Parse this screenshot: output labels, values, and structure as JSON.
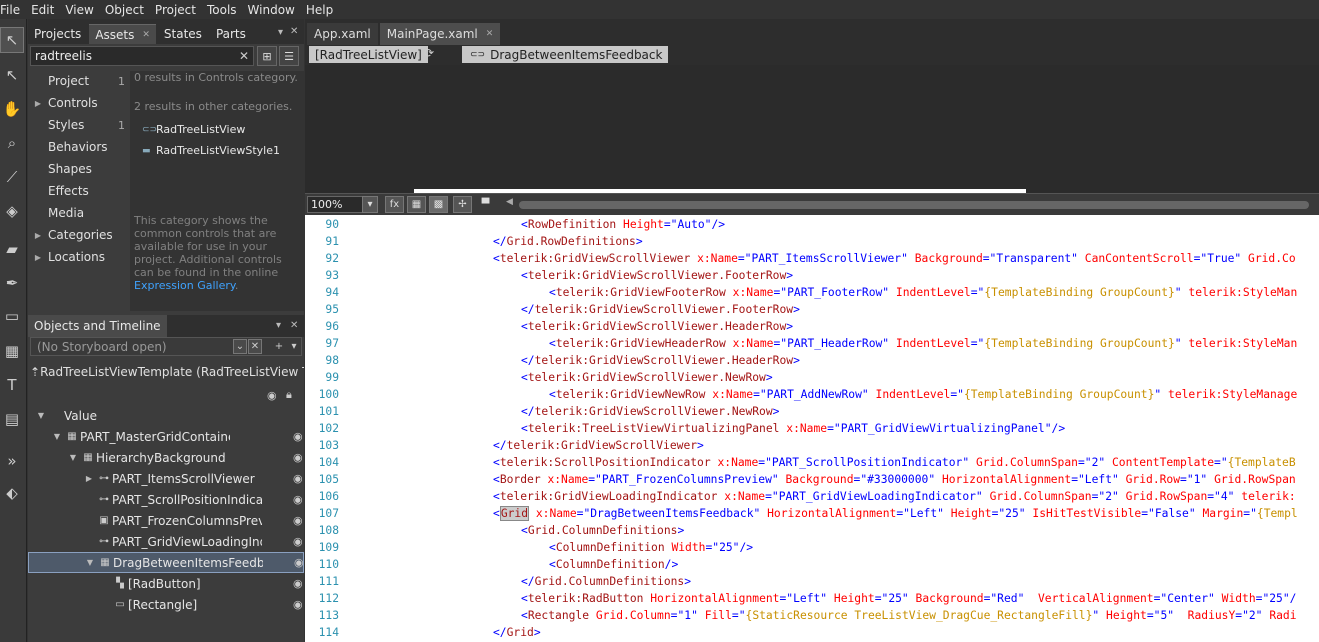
{
  "menu": [
    "File",
    "Edit",
    "View",
    "Object",
    "Project",
    "Tools",
    "Window",
    "Help"
  ],
  "assets_tabs": [
    "Projects",
    "Assets",
    "States",
    "Parts"
  ],
  "search_value": "radtreelis",
  "categories": [
    {
      "label": "Project",
      "count": "1",
      "expand": ""
    },
    {
      "label": "Controls",
      "count": "",
      "expand": "▶"
    },
    {
      "label": "Styles",
      "count": "1",
      "expand": ""
    },
    {
      "label": "Behaviors",
      "count": "",
      "expand": ""
    },
    {
      "label": "Shapes",
      "count": "",
      "expand": ""
    },
    {
      "label": "Effects",
      "count": "",
      "expand": ""
    },
    {
      "label": "Media",
      "count": "",
      "expand": ""
    },
    {
      "label": "Categories",
      "count": "",
      "expand": "▶"
    },
    {
      "label": "Locations",
      "count": "",
      "expand": "▶"
    }
  ],
  "results_controls": "0 results in Controls category.",
  "results_other": "2 results in other categories.",
  "asset_items": [
    "RadTreeListView",
    "RadTreeListViewStyle1"
  ],
  "desc_text": "This category shows the common controls that are available for use in your project. Additional controls can be found in the online",
  "desc_link": "Expression Gallery",
  "objects_title": "Objects and Timeline",
  "storyboard": "(No Storyboard open)",
  "template_name": "RadTreeListViewTemplate (RadTreeListView Tem...",
  "tree": [
    {
      "label": "Value",
      "indent": 0,
      "exp": "▼",
      "icon": "",
      "eye": false,
      "sel": false
    },
    {
      "label": "PART_MasterGridContainer",
      "indent": 1,
      "exp": "▼",
      "icon": "▦",
      "eye": true,
      "sel": false
    },
    {
      "label": "HierarchyBackground",
      "indent": 2,
      "exp": "▼",
      "icon": "▦",
      "eye": true,
      "sel": false
    },
    {
      "label": "PART_ItemsScrollViewer",
      "indent": 3,
      "exp": "▶",
      "icon": "⊶",
      "eye": true,
      "sel": false
    },
    {
      "label": "PART_ScrollPositionIndicator",
      "indent": 3,
      "exp": "",
      "icon": "⊶",
      "eye": true,
      "sel": false
    },
    {
      "label": "PART_FrozenColumnsPreview",
      "indent": 3,
      "exp": "",
      "icon": "▣",
      "eye": true,
      "sel": false
    },
    {
      "label": "PART_GridViewLoadingIndicat",
      "indent": 3,
      "exp": "",
      "icon": "⊶",
      "eye": true,
      "sel": false
    },
    {
      "label": "DragBetweenItemsFeedback",
      "indent": 3,
      "exp": "▼",
      "icon": "▦",
      "eye": true,
      "sel": true
    },
    {
      "label": "[RadButton]",
      "indent": 4,
      "exp": "",
      "icon": "▚",
      "eye": true,
      "sel": false
    },
    {
      "label": "[Rectangle]",
      "indent": 4,
      "exp": "",
      "icon": "▭",
      "eye": true,
      "sel": false
    }
  ],
  "doc_tabs": [
    "App.xaml",
    "MainPage.xaml"
  ],
  "breadcrumb": [
    "[RadTreeListView]",
    "DragBetweenItemsFeedback"
  ],
  "zoom": "100%",
  "code_lines": [
    {
      "n": "90",
      "i": 2,
      "h": "<span class='b'>&lt;</span><span class='t'>RowDefinition</span> <span class='a'>Height</span><span class='b'>=\"Auto\"/&gt;</span>"
    },
    {
      "n": "91",
      "i": 1,
      "h": "<span class='b'>&lt;/</span><span class='t'>Grid.RowDefinitions</span><span class='b'>&gt;</span>"
    },
    {
      "n": "92",
      "i": 1,
      "h": "<span class='b'>&lt;</span><span class='t'>telerik:GridViewScrollViewer</span> <span class='a'>x:Name</span><span class='b'>=\"PART_ItemsScrollViewer\"</span> <span class='a'>Background</span><span class='b'>=\"Transparent\"</span> <span class='a'>CanContentScroll</span><span class='b'>=\"True\"</span> <span class='a'>Grid.Co</span>"
    },
    {
      "n": "93",
      "i": 2,
      "h": "<span class='b'>&lt;</span><span class='t'>telerik:GridViewScrollViewer.FooterRow</span><span class='b'>&gt;</span>"
    },
    {
      "n": "94",
      "i": 3,
      "h": "<span class='b'>&lt;</span><span class='t'>telerik:GridViewFooterRow</span> <span class='a'>x:Name</span><span class='b'>=\"PART_FooterRow\"</span> <span class='a'>IndentLevel</span><span class='b'>=\"</span><span class='m'>{TemplateBinding GroupCount}</span><span class='b'>\"</span> <span class='a'>telerik:StyleMan</span>"
    },
    {
      "n": "95",
      "i": 2,
      "h": "<span class='b'>&lt;/</span><span class='t'>telerik:GridViewScrollViewer.FooterRow</span><span class='b'>&gt;</span>"
    },
    {
      "n": "96",
      "i": 2,
      "h": "<span class='b'>&lt;</span><span class='t'>telerik:GridViewScrollViewer.HeaderRow</span><span class='b'>&gt;</span>"
    },
    {
      "n": "97",
      "i": 3,
      "h": "<span class='b'>&lt;</span><span class='t'>telerik:GridViewHeaderRow</span> <span class='a'>x:Name</span><span class='b'>=\"PART_HeaderRow\"</span> <span class='a'>IndentLevel</span><span class='b'>=\"</span><span class='m'>{TemplateBinding GroupCount}</span><span class='b'>\"</span> <span class='a'>telerik:StyleMan</span>"
    },
    {
      "n": "98",
      "i": 2,
      "h": "<span class='b'>&lt;/</span><span class='t'>telerik:GridViewScrollViewer.HeaderRow</span><span class='b'>&gt;</span>"
    },
    {
      "n": "99",
      "i": 2,
      "h": "<span class='b'>&lt;</span><span class='t'>telerik:GridViewScrollViewer.NewRow</span><span class='b'>&gt;</span>"
    },
    {
      "n": "100",
      "i": 3,
      "h": "<span class='b'>&lt;</span><span class='t'>telerik:GridViewNewRow</span> <span class='a'>x:Name</span><span class='b'>=\"PART_AddNewRow\"</span> <span class='a'>IndentLevel</span><span class='b'>=\"</span><span class='m'>{TemplateBinding GroupCount}</span><span class='b'>\"</span> <span class='a'>telerik:StyleManage</span>"
    },
    {
      "n": "101",
      "i": 2,
      "h": "<span class='b'>&lt;/</span><span class='t'>telerik:GridViewScrollViewer.NewRow</span><span class='b'>&gt;</span>"
    },
    {
      "n": "102",
      "i": 2,
      "h": "<span class='b'>&lt;</span><span class='t'>telerik:TreeListViewVirtualizingPanel</span> <span class='a'>x:Name</span><span class='b'>=\"PART_GridViewVirtualizingPanel\"/&gt;</span>"
    },
    {
      "n": "103",
      "i": 1,
      "h": "<span class='b'>&lt;/</span><span class='t'>telerik:GridViewScrollViewer</span><span class='b'>&gt;</span>"
    },
    {
      "n": "104",
      "i": 1,
      "h": "<span class='b'>&lt;</span><span class='t'>telerik:ScrollPositionIndicator</span> <span class='a'>x:Name</span><span class='b'>=\"PART_ScrollPositionIndicator\"</span> <span class='a'>Grid.ColumnSpan</span><span class='b'>=\"2\"</span> <span class='a'>ContentTemplate</span><span class='b'>=\"</span><span class='m'>{TemplateB</span>"
    },
    {
      "n": "105",
      "i": 1,
      "h": "<span class='b'>&lt;</span><span class='t'>Border</span> <span class='a'>x:Name</span><span class='b'>=\"PART_FrozenColumnsPreview\"</span> <span class='a'>Background</span><span class='b'>=\"#33000000\"</span> <span class='a'>HorizontalAlignment</span><span class='b'>=\"Left\"</span> <span class='a'>Grid.Row</span><span class='b'>=\"1\"</span> <span class='a'>Grid.RowSpan</span>"
    },
    {
      "n": "106",
      "i": 1,
      "h": "<span class='b'>&lt;</span><span class='t'>telerik:GridViewLoadingIndicator</span> <span class='a'>x:Name</span><span class='b'>=\"PART_GridViewLoadingIndicator\"</span> <span class='a'>Grid.ColumnSpan</span><span class='b'>=\"2\"</span> <span class='a'>Grid.RowSpan</span><span class='b'>=\"4\"</span> <span class='a'>telerik:</span>"
    },
    {
      "n": "107",
      "i": 1,
      "h": "<span class='b'>&lt;</span><span class='t hl'>Grid</span> <span class='a'>x:Name</span><span class='b'>=\"DragBetweenItemsFeedback\"</span> <span class='a'>HorizontalAlignment</span><span class='b'>=\"Left\"</span> <span class='a'>Height</span><span class='b'>=\"25\"</span> <span class='a'>IsHitTestVisible</span><span class='b'>=\"False\"</span> <span class='a'>Margin</span><span class='b'>=\"</span><span class='m'>{Templ</span>"
    },
    {
      "n": "108",
      "i": 2,
      "h": "<span class='b'>&lt;</span><span class='t'>Grid.ColumnDefinitions</span><span class='b'>&gt;</span>"
    },
    {
      "n": "109",
      "i": 3,
      "h": "<span class='b'>&lt;</span><span class='t'>ColumnDefinition</span> <span class='a'>Width</span><span class='b'>=\"25\"/&gt;</span>"
    },
    {
      "n": "110",
      "i": 3,
      "h": "<span class='b'>&lt;</span><span class='t'>ColumnDefinition</span><span class='b'>/&gt;</span>"
    },
    {
      "n": "111",
      "i": 2,
      "h": "<span class='b'>&lt;/</span><span class='t'>Grid.ColumnDefinitions</span><span class='b'>&gt;</span>"
    },
    {
      "n": "112",
      "i": 2,
      "h": "<span class='b'>&lt;</span><span class='t'>telerik:RadButton</span> <span class='a'>HorizontalAlignment</span><span class='b'>=\"Left\"</span> <span class='a'>Height</span><span class='b'>=\"25\"</span> <span class='a'>Background</span><span class='b'>=\"Red\"</span>  <span class='a'>VerticalAlignment</span><span class='b'>=\"Center\"</span> <span class='a'>Width</span><span class='b'>=\"25\"/</span>"
    },
    {
      "n": "113",
      "i": 2,
      "h": "<span class='b'>&lt;</span><span class='t'>Rectangle</span> <span class='a'>Grid.Column</span><span class='b'>=\"1\"</span> <span class='a'>Fill</span><span class='b'>=\"</span><span class='m'>{StaticResource TreeListView_DragCue_RectangleFill}</span><span class='b'>\"</span> <span class='a'>Height</span><span class='b'>=\"5\"</span>  <span class='a'>RadiusY</span><span class='b'>=\"2\"</span> <span class='a'>Radi</span>"
    },
    {
      "n": "114",
      "i": 1,
      "h": "<span class='b'>&lt;/</span><span class='t'>Grid</span><span class='b'>&gt;</span>"
    }
  ]
}
